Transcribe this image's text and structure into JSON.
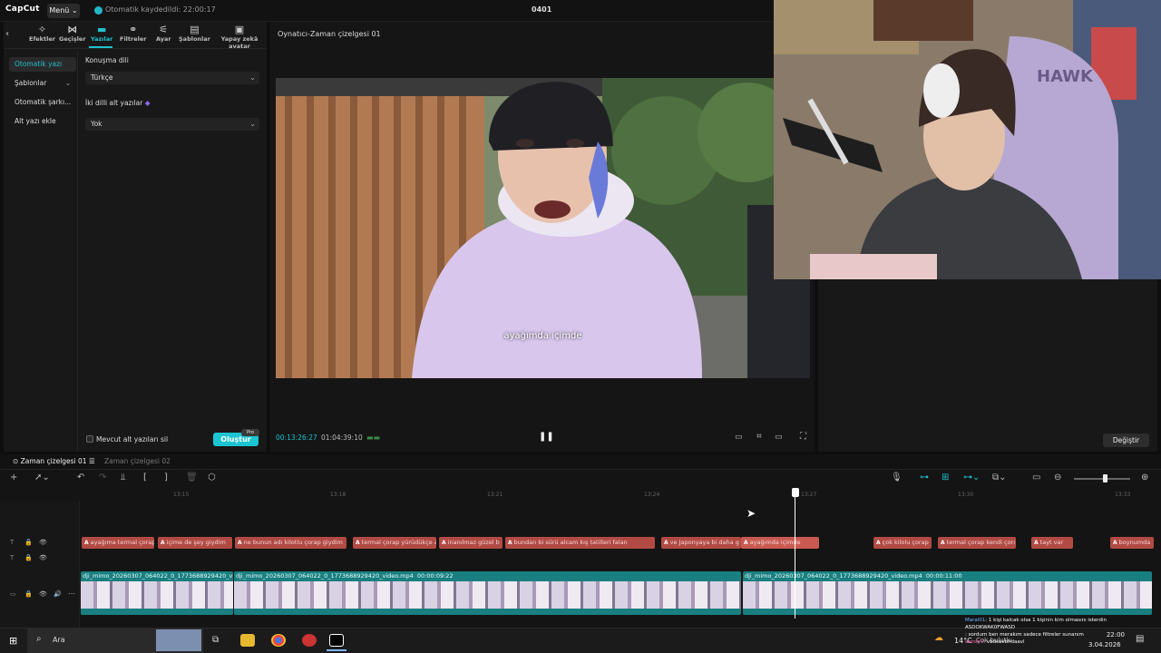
{
  "app": {
    "logo": "CapCut",
    "menu_label": "Menü",
    "autosave_text": "Otomatik kaydedildi: 22:00:17",
    "project_title": "0401"
  },
  "tabs": [
    {
      "label": "Efektler",
      "icon": "sparkle-icon"
    },
    {
      "label": "Geçişler",
      "icon": "bowtie-icon"
    },
    {
      "label": "Yazılar",
      "icon": "text-icon",
      "active": true
    },
    {
      "label": "Filtreler",
      "icon": "filter-icon"
    },
    {
      "label": "Ayar",
      "icon": "adjust-icon"
    },
    {
      "label": "Şablonlar",
      "icon": "template-icon"
    },
    {
      "label": "Yapay zekâ avatar",
      "icon": "avatar-icon"
    }
  ],
  "sidenav": [
    {
      "label": "Otomatik yazı",
      "active": true
    },
    {
      "label": "Şablonlar",
      "chevron": "⌄"
    },
    {
      "label": "Otomatik şarkı..."
    },
    {
      "label": "Alt yazı ekle"
    }
  ],
  "caption_panel": {
    "speech_lang_label": "Konuşma dili",
    "speech_lang_value": "Türkçe",
    "bilingual_label": "İki dilli alt yazılar",
    "bilingual_value": "Yok",
    "delete_existing_label": "Mevcut alt yazıları sil",
    "create_label": "Oluştur",
    "pro_badge": "Pro"
  },
  "player": {
    "title": "Oynatıcı-Zaman çizelgesi 01",
    "subtitle_text": "ayağımda içimde",
    "current_time": "00:13:26:27",
    "total_time": "01:04:39:10"
  },
  "right_panel": {
    "change_label": "Değiştir"
  },
  "timeline": {
    "tab_active": "Zaman çizelgesi 01",
    "tab_other": "Zaman çizelgesi 02",
    "ticks": [
      "13:15",
      "13:18",
      "13:21",
      "13:24",
      "13:27",
      "13:30",
      "13:33"
    ],
    "subtitle_clips": [
      "ayağıma termal çorap gi",
      "içime de şey giydim",
      "ne bunun adı kilotlu çorap giydim",
      "termal çorap yürüdükçe a",
      "inanılmaz güzel b",
      "bundan bi sürü alcam kış tatilleri falan",
      "ve Japonyaya bi daha g",
      "ayağımda içimde",
      "çok kilolu çorap",
      "termal çorap kendi çorı",
      "tayt var",
      "boynumda"
    ],
    "video_clips": [
      {
        "name": "dji_mimo_20260307_064022_0_1773688929420_video.mp4",
        "dur": ""
      },
      {
        "name": "dji_mimo_20260307_064022_0_1773688929420_video.mp4",
        "dur": "00:00:09:22"
      },
      {
        "name": "dji_mimo_20260307_064022_0_1773688929420_video.mp4",
        "dur": "00:00:11:00"
      }
    ]
  },
  "taskbar": {
    "search_label": "Ara",
    "weather": "14°C",
    "weather_desc": "Çok bulutlu",
    "clock_time": "22:00",
    "clock_date": "3.04.2026"
  },
  "chat": [
    {
      "user": "Maral01",
      "text": ": 1 kişi kalcak olsa 1 kişinin kim olmasını isterdin"
    },
    {
      "user": "",
      "text": "ASDOKWAK0FWASD"
    },
    {
      "user": "",
      "text": ": sordum ben merakım sadece filtreler sunanım"
    },
    {
      "user": "aersinV",
      "text": ": vbdsavbhdaavl"
    }
  ]
}
